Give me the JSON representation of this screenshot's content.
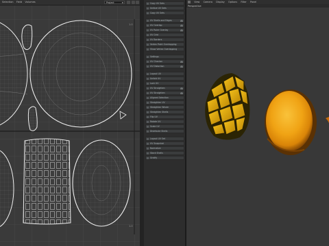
{
  "uv_editor": {
    "menu": [
      "Selection",
      "Field",
      "Volumes"
    ],
    "project_dropdown": "Project",
    "corner_top": "1.0",
    "corner_bottom": "1.0"
  },
  "options_panel": {
    "items": [
      {
        "label": "Copy UV Sets"
      },
      {
        "label": "Unitize UV Sets"
      },
      {
        "label": "Copy UV Sets"
      },
      {
        "label": "UV Shells and Edges"
      },
      {
        "label": "UV Overlap"
      },
      {
        "label": "UV Ruler Overlay"
      },
      {
        "label": "UV Grid"
      },
      {
        "label": "UV Borders"
      },
      {
        "label": "Vertex Point Overlapping"
      },
      {
        "label": "Show Vertex Overlapping"
      },
      {
        "label": "Settings"
      },
      {
        "label": "UV Checker"
      },
      {
        "label": "UV Distortion"
      },
      {
        "label": "Layout UV"
      },
      {
        "label": "Unfold UV"
      },
      {
        "label": "Lock UV"
      },
      {
        "label": "UV Straighten"
      },
      {
        "label": "UV Straighten"
      },
      {
        "label": "Aligned Selection"
      },
      {
        "label": "Straighten UV"
      },
      {
        "label": "Straighten Whole"
      },
      {
        "label": "Straighten Shells"
      },
      {
        "label": "Flip UV"
      },
      {
        "label": "Rotate UV"
      },
      {
        "label": "Scale UV"
      },
      {
        "label": "Distribute Shells"
      },
      {
        "label": "Layout UV Set"
      },
      {
        "label": "UV Snapshot"
      },
      {
        "label": "Normalize"
      },
      {
        "label": "Stack Shells"
      },
      {
        "label": "Gridify"
      }
    ]
  },
  "viewport": {
    "menu": [
      "View",
      "Camera",
      "Display",
      "Options",
      "Filter",
      "Panel"
    ],
    "camera_label": "Perspective"
  },
  "colors": {
    "uv_background": "#3a3a3a",
    "grid_line": "#4c4c4c",
    "uv_shell_line": "#efefef",
    "panel_item": "#3a3c3d",
    "viewport_background": "#383838",
    "mango_yellow": "#f0a814"
  }
}
